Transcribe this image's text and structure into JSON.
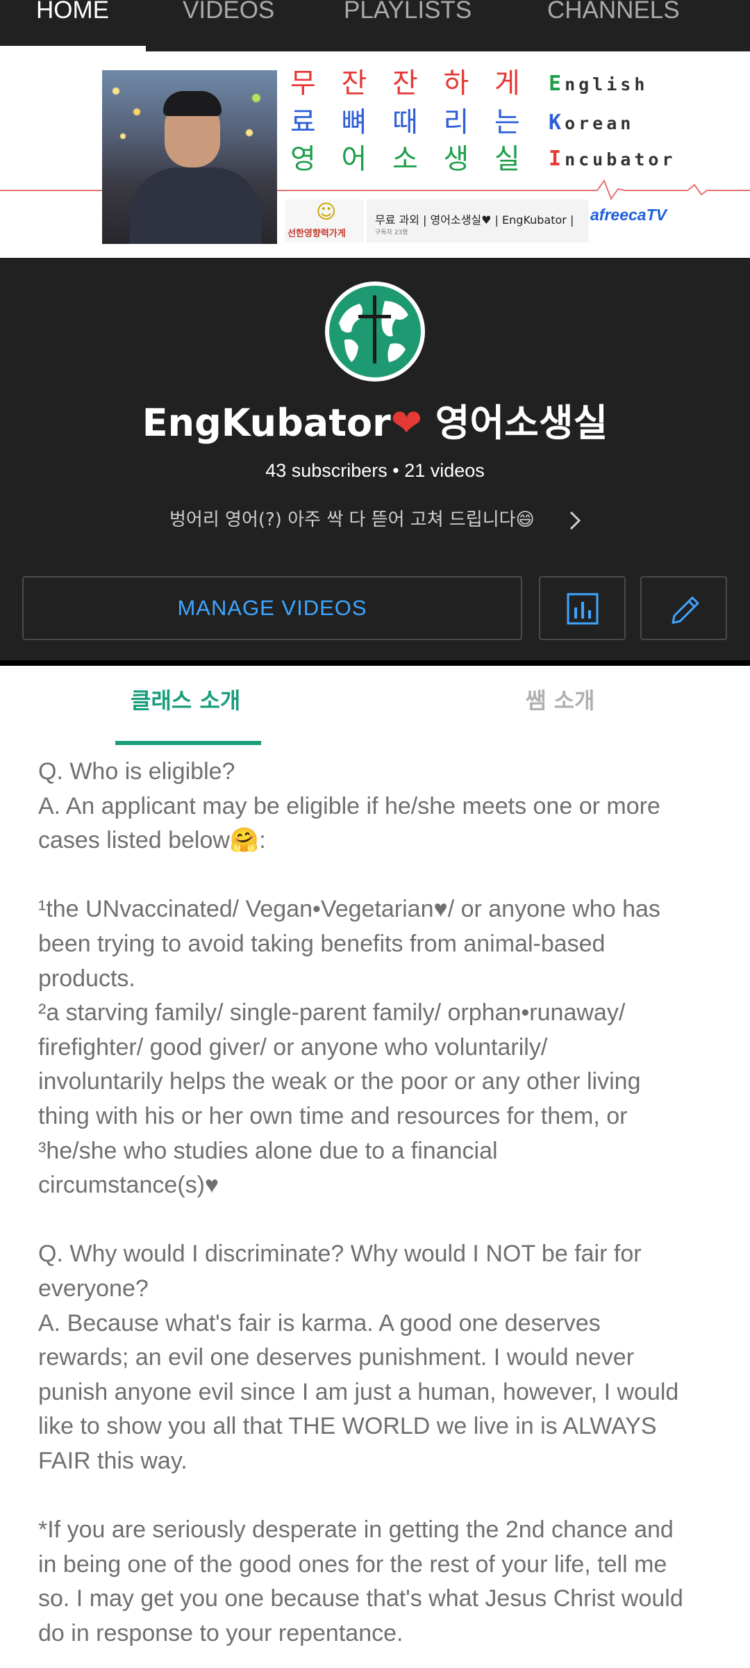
{
  "tabs": [
    "HOME",
    "VIDEOS",
    "PLAYLISTS",
    "CHANNELS"
  ],
  "banner": {
    "korean_lines": [
      "무 잔 잔 하 게",
      "료 뼈 때 리 는",
      "영 어 소 생 실"
    ],
    "english_lines": [
      {
        "initial": "E",
        "rest": "nglish"
      },
      {
        "initial": "K",
        "rest": "orean"
      },
      {
        "initial": "I",
        "rest": "ncubator"
      }
    ],
    "logo_text": "선한영향력가게",
    "info_text": "무료 과외 | 영어소생실♥ | EngKubator |",
    "info_subtext": "구독자 23명",
    "platform": "afreecaTV"
  },
  "channel": {
    "name": "EngKubator",
    "name_suffix": " 영어소생실",
    "heart": "❤",
    "stats": "43 subscribers • 21 videos",
    "description": "벙어리 영어(?) 아주 싹 다 뜯어 고쳐 드립니다😄"
  },
  "buttons": {
    "manage": "MANAGE VIDEOS"
  },
  "inner_tabs": [
    "클래스 소개",
    "쌤 소개"
  ],
  "about_lines": [
    "Q. Who is eligible?",
    "A. An applicant may be eligible if he/she meets one or more",
    "cases listed below🤗:",
    "",
    "¹the UNvaccinated/ Vegan•Vegetarian♥/ or anyone who has",
    "been trying to avoid taking benefits from animal-based",
    "products.",
    "²a starving family/ single-parent family/ orphan•runaway/",
    "firefighter/ good giver/ or anyone who voluntarily/",
    "involuntarily helps the weak or the poor or any other living",
    "thing with his or her own time and resources for them, or",
    "³he/she who studies alone due to a financial",
    "circumstance(s)♥",
    "",
    "Q. Why would I discriminate? Why would I NOT be fair for",
    "everyone?",
    "A. Because what's fair is karma. A good one deserves",
    "rewards; an evil one deserves punishment. I would never",
    "punish anyone evil since I am just a human, however, I would",
    "like to show you all that THE WORLD we live in is ALWAYS",
    "FAIR this way.",
    "",
    "*If you are seriously desperate in getting the 2nd chance and",
    "in being one of the good ones for the rest of your life, tell me",
    "so. I may get you one because that's what Jesus Christ would",
    "do in response to your repentance."
  ],
  "colors": {
    "header_bg": "#212121",
    "accent_blue": "#3ea6ff",
    "tab_green": "#1a9d7c",
    "heart_red": "#e53935"
  }
}
